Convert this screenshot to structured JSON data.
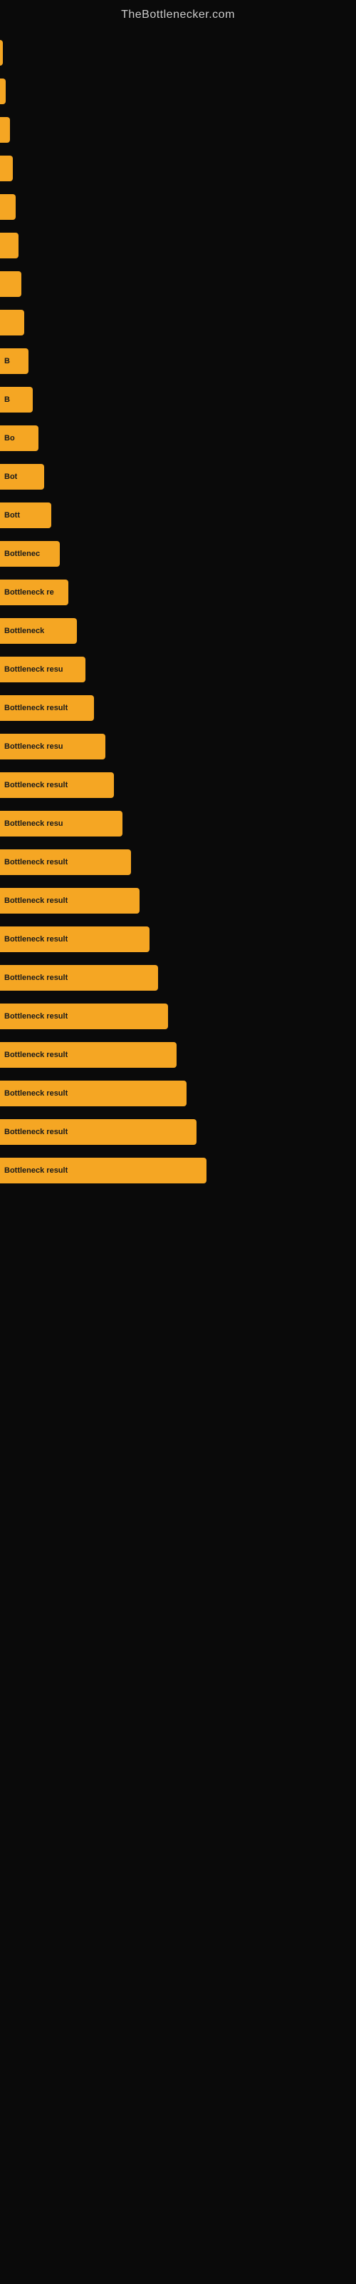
{
  "site": {
    "title": "TheBottlenecker.com"
  },
  "bars": [
    {
      "id": 1,
      "label": "",
      "width_class": "bar-w-1"
    },
    {
      "id": 2,
      "label": "",
      "width_class": "bar-w-2"
    },
    {
      "id": 3,
      "label": "",
      "width_class": "bar-w-3"
    },
    {
      "id": 4,
      "label": "",
      "width_class": "bar-w-4"
    },
    {
      "id": 5,
      "label": "",
      "width_class": "bar-w-5"
    },
    {
      "id": 6,
      "label": "",
      "width_class": "bar-w-6"
    },
    {
      "id": 7,
      "label": "",
      "width_class": "bar-w-7"
    },
    {
      "id": 8,
      "label": "",
      "width_class": "bar-w-8"
    },
    {
      "id": 9,
      "label": "B",
      "width_class": "bar-w-9"
    },
    {
      "id": 10,
      "label": "B",
      "width_class": "bar-w-10"
    },
    {
      "id": 11,
      "label": "Bo",
      "width_class": "bar-w-11"
    },
    {
      "id": 12,
      "label": "Bot",
      "width_class": "bar-w-12"
    },
    {
      "id": 13,
      "label": "Bott",
      "width_class": "bar-w-13"
    },
    {
      "id": 14,
      "label": "Bottlenec",
      "width_class": "bar-w-14"
    },
    {
      "id": 15,
      "label": "Bottleneck re",
      "width_class": "bar-w-15"
    },
    {
      "id": 16,
      "label": "Bottleneck",
      "width_class": "bar-w-16"
    },
    {
      "id": 17,
      "label": "Bottleneck resu",
      "width_class": "bar-w-17"
    },
    {
      "id": 18,
      "label": "Bottleneck result",
      "width_class": "bar-w-18"
    },
    {
      "id": 19,
      "label": "Bottleneck resu",
      "width_class": "bar-w-19"
    },
    {
      "id": 20,
      "label": "Bottleneck result",
      "width_class": "bar-w-20"
    },
    {
      "id": 21,
      "label": "Bottleneck resu",
      "width_class": "bar-w-21"
    },
    {
      "id": 22,
      "label": "Bottleneck result",
      "width_class": "bar-w-22"
    },
    {
      "id": 23,
      "label": "Bottleneck result",
      "width_class": "bar-w-23"
    },
    {
      "id": 24,
      "label": "Bottleneck result",
      "width_class": "bar-w-24"
    },
    {
      "id": 25,
      "label": "Bottleneck result",
      "width_class": "bar-w-25"
    },
    {
      "id": 26,
      "label": "Bottleneck result",
      "width_class": "bar-w-26"
    },
    {
      "id": 27,
      "label": "Bottleneck result",
      "width_class": "bar-w-27"
    },
    {
      "id": 28,
      "label": "Bottleneck result",
      "width_class": "bar-w-28"
    },
    {
      "id": 29,
      "label": "Bottleneck result",
      "width_class": "bar-w-29"
    },
    {
      "id": 30,
      "label": "Bottleneck result",
      "width_class": "bar-w-30"
    }
  ]
}
